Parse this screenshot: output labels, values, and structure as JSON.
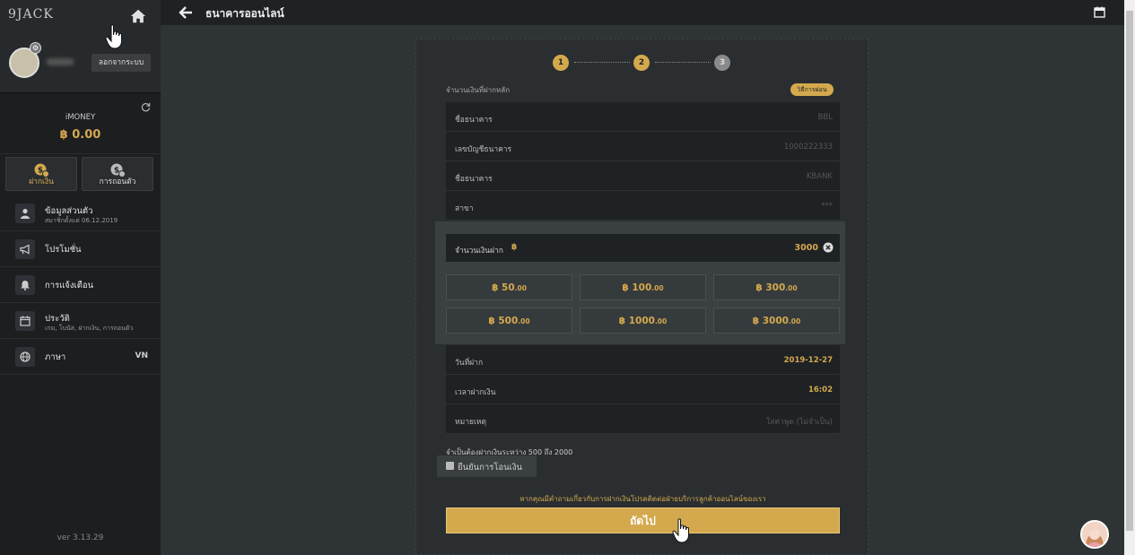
{
  "sidebar": {
    "logo": "9JACK",
    "logout_label": "ลอกจากระบบ",
    "wallet": {
      "label": "iMONEY",
      "balance": "฿ 0.00"
    },
    "actions": [
      {
        "label": "ฝากเงิน"
      },
      {
        "label": "การถอนตัว"
      }
    ],
    "menu": [
      {
        "title": "ข้อมูลส่วนตัว",
        "sub": "สมาชิกตั้งแต่ 06.12.2019"
      },
      {
        "title": "โปรโมชั่น"
      },
      {
        "title": "การแจ้งเตือน"
      },
      {
        "title": "ประวัติ",
        "sub": "เกม, โบนัส, ฝากเงิน, การถอนตัว"
      },
      {
        "title": "ภาษา",
        "right": "VN"
      }
    ],
    "version": "ver 3.13.29"
  },
  "header": {
    "title": "ธนาคารออนไลน์"
  },
  "steps": [
    "1",
    "2",
    "3"
  ],
  "form": {
    "section_label": "จำนวนเงินที่ฝากหลัก",
    "howto_label": "วิธีการฝอน",
    "bank_rows": [
      {
        "key": "ชื่อธนาคาร",
        "value": "BBL"
      },
      {
        "key": "เลขบัญชีธนาคาร",
        "value": "1000222333"
      },
      {
        "key": "ชื่อธนาคาร",
        "value": "KBANK"
      },
      {
        "key": "สาขา",
        "value": "***"
      }
    ],
    "amount": {
      "label": "จำนวนเงินฝาก",
      "currency": "฿",
      "value": "3000"
    },
    "presets": [
      {
        "main": "฿ 50",
        "dec": ".00"
      },
      {
        "main": "฿ 100",
        "dec": ".00"
      },
      {
        "main": "฿ 300",
        "dec": ".00"
      },
      {
        "main": "฿ 500",
        "dec": ".00"
      },
      {
        "main": "฿ 1000",
        "dec": ".00"
      },
      {
        "main": "฿ 3000",
        "dec": ".00"
      }
    ],
    "date_row": {
      "key": "วันที่ฝาก",
      "value": "2019-12-27"
    },
    "time_row": {
      "key": "เวลาฝากเงิน",
      "value": "16:02"
    },
    "note_row": {
      "key": "หมายเหตุ",
      "placeholder": "ใส่ค่าพูด (ไม่จำเป็น)"
    },
    "range_note": "จำเป็นต้องฝากเงินระหว่าง 500 ถึง 2000",
    "confirm_label": "ยืนยันการโอนเงิน",
    "contact_note": "หากคุณมีคำถามเกี่ยวกับการฝากเงินโปรดติดต่อฝ่ายบริการลูกค้าออนไลน์ของเรา",
    "next_label": "ถัดไป"
  },
  "colors": {
    "accent": "#d4a94e",
    "sidebar": "#1c1e20",
    "background": "#2e3335"
  }
}
